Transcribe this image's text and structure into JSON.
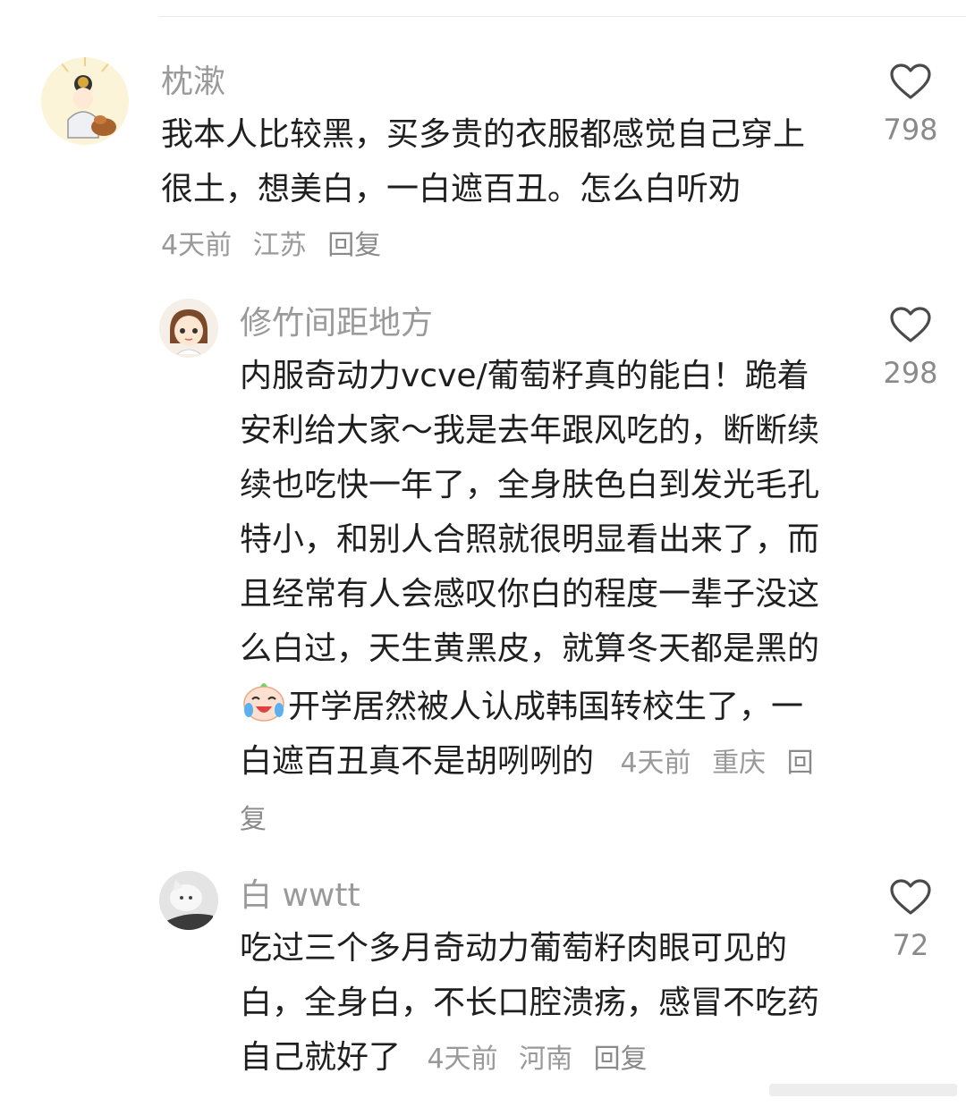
{
  "comments": [
    {
      "username": "枕漱",
      "text": "我本人比较黑，买多贵的衣服都感觉自己穿上很土，想美白，一白遮百丑。怎么白听劝",
      "time": "4天前",
      "location": "江苏",
      "reply_label": "回复",
      "likes": "798"
    },
    {
      "username": "修竹间距地方",
      "text_before_emoji": "内服奇动力vcve/葡萄籽真的能白！跪着安利给大家～我是去年跟风吃的，断断续续也吃快一年了，全身肤色白到发光毛孔特小，和别人合照就很明显看出来了，而且经常有人会感叹你白的程度一辈子没这么白过，天生黄黑皮，就算冬天都是黑的",
      "text_after_emoji": "开学居然被人认成韩国转校生了，一白遮百丑真不是胡咧咧的",
      "emoji": "crying-laughing-emoji",
      "time": "4天前",
      "location": "重庆",
      "reply_label": "回复",
      "likes": "298"
    },
    {
      "username": "白 wwtt",
      "text": "吃过三个多月奇动力葡萄籽肉眼可见的白，全身白，不长口腔溃疡，感冒不吃药自己就好了",
      "time": "4天前",
      "location": "河南",
      "reply_label": "回复",
      "likes": "72"
    }
  ],
  "icons": {
    "like": "heart-outline-icon"
  },
  "colors": {
    "username": "#9a9a9a",
    "meta": "#999999",
    "text": "#1f1f1f"
  }
}
